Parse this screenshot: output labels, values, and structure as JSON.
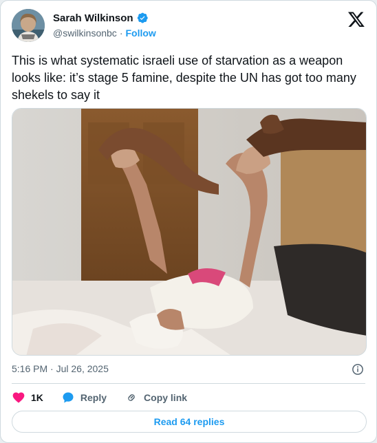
{
  "author": {
    "name": "Sarah Wilkinson",
    "handle": "@swilkinsonbc",
    "separator": "·",
    "follow_label": "Follow",
    "verified": true
  },
  "tweet": {
    "text": "This is what systematic israeli use of starvation as a weapon looks like: it’s stage 5 famine, despite the UN has got too many shekels to say it",
    "media_icon": "photo",
    "timestamp": "5:16 PM · Jul 26, 2025"
  },
  "actions": {
    "likes_count": "1K",
    "reply_label": "Reply",
    "copy_link_label": "Copy link"
  },
  "footer": {
    "read_replies_label": "Read 64 replies"
  },
  "colors": {
    "accent": "#1d9bf0",
    "like": "#f91880",
    "text_primary": "#0f1419",
    "text_secondary": "#536471",
    "border": "#cfd9de"
  }
}
